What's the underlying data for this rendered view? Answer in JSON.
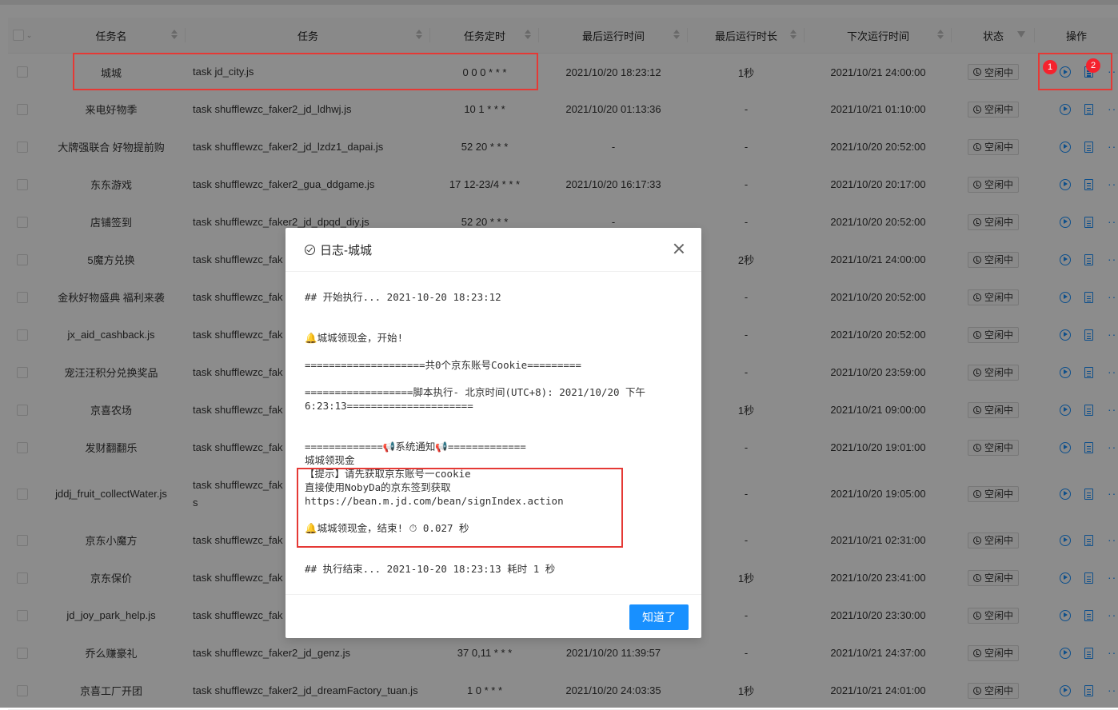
{
  "table": {
    "headers": {
      "name": "任务名",
      "task": "任务",
      "cron": "任务定时",
      "last_run": "最后运行时间",
      "last_duration": "最后运行时长",
      "next_run": "下次运行时间",
      "status": "状态",
      "ops": "操作"
    },
    "rows": [
      {
        "name": "城城",
        "task": "task jd_city.js",
        "cron": "0 0 0 * * *",
        "last": "2021/10/20 18:23:12",
        "dur": "1秒",
        "next": "2021/10/21 24:00:00",
        "status": "空闲中"
      },
      {
        "name": "来电好物季",
        "task": "task shufflewzc_faker2_jd_ldhwj.js",
        "cron": "10 1 * * *",
        "last": "2021/10/20 01:13:36",
        "dur": "-",
        "next": "2021/10/21 01:10:00",
        "status": "空闲中"
      },
      {
        "name": "大牌强联合 好物提前购",
        "task": "task shufflewzc_faker2_jd_lzdz1_dapai.js",
        "cron": "52 20 * * *",
        "last": "-",
        "dur": "-",
        "next": "2021/10/20 20:52:00",
        "status": "空闲中"
      },
      {
        "name": "东东游戏",
        "task": "task shufflewzc_faker2_gua_ddgame.js",
        "cron": "17 12-23/4 * * *",
        "last": "2021/10/20 16:17:33",
        "dur": "-",
        "next": "2021/10/20 20:17:00",
        "status": "空闲中"
      },
      {
        "name": "店铺签到",
        "task": "task shufflewzc_faker2_jd_dpqd_diy.js",
        "cron": "52 20 * * *",
        "last": "-",
        "dur": "-",
        "next": "2021/10/20 20:52:00",
        "status": "空闲中"
      },
      {
        "name": "5魔方兑换",
        "task": "task shufflewzc_fak",
        "cron": "",
        "last": "",
        "dur": "2秒",
        "next": "2021/10/21 24:00:00",
        "status": "空闲中"
      },
      {
        "name": "金秋好物盛典 福利来袭",
        "task": "task shufflewzc_fak",
        "cron": "",
        "last": "",
        "dur": "-",
        "next": "2021/10/20 20:52:00",
        "status": "空闲中"
      },
      {
        "name": "jx_aid_cashback.js",
        "task": "task shufflewzc_fak",
        "cron": "",
        "last": "",
        "dur": "-",
        "next": "2021/10/20 20:52:00",
        "status": "空闲中"
      },
      {
        "name": "宠汪汪积分兑换奖品",
        "task": "task shufflewzc_fak",
        "cron": "",
        "last": "",
        "dur": "-",
        "next": "2021/10/20 23:59:00",
        "status": "空闲中"
      },
      {
        "name": "京喜农场",
        "task": "task shufflewzc_fak",
        "cron": "",
        "last": "",
        "dur": "1秒",
        "next": "2021/10/21 09:00:00",
        "status": "空闲中"
      },
      {
        "name": "发财翻翻乐",
        "task": "task shufflewzc_fak",
        "cron": "",
        "last": "",
        "dur": "-",
        "next": "2021/10/20 19:01:00",
        "status": "空闲中"
      },
      {
        "name": "jddj_fruit_collectWater.js",
        "task": "task shufflewzc_fak",
        "task2": "s",
        "cron": "",
        "last": "",
        "dur": "-",
        "next": "2021/10/20 19:05:00",
        "status": "空闲中"
      },
      {
        "name": "京东小魔方",
        "task": "task shufflewzc_fak",
        "cron": "",
        "last": "",
        "dur": "-",
        "next": "2021/10/21 02:31:00",
        "status": "空闲中"
      },
      {
        "name": "京东保价",
        "task": "task shufflewzc_fak",
        "cron": "",
        "last": "",
        "dur": "1秒",
        "next": "2021/10/20 23:41:00",
        "status": "空闲中"
      },
      {
        "name": "jd_joy_park_help.js",
        "task": "task shufflewzc_fak",
        "cron": "",
        "last": "",
        "dur": "-",
        "next": "2021/10/20 23:30:00",
        "status": "空闲中"
      },
      {
        "name": "乔么赚豪礼",
        "task": "task shufflewzc_faker2_jd_genz.js",
        "cron": "37 0,11 * * *",
        "last": "2021/10/20 11:39:57",
        "dur": "-",
        "next": "2021/10/21 24:37:00",
        "status": "空闲中"
      },
      {
        "name": "京喜工厂开团",
        "task": "task shufflewzc_faker2_jd_dreamFactory_tuan.js",
        "cron": "1 0 * * *",
        "last": "2021/10/20 24:03:35",
        "dur": "1秒",
        "next": "2021/10/21 24:01:00",
        "status": "空闲中"
      }
    ]
  },
  "annotations": {
    "badge1": "1",
    "badge2": "2"
  },
  "modal": {
    "title": "日志-城城",
    "log_lines": [
      {
        "t": "## 开始执行... 2021-10-20 18:23:12",
        "gap": 0
      },
      {
        "t": "",
        "gap": 0
      },
      {
        "t": "",
        "gap": 0
      },
      {
        "t": "🔔城城领现金，开始!",
        "gap": 0
      },
      {
        "t": "",
        "gap": 0
      },
      {
        "t": "====================共0个京东账号Cookie=========",
        "gap": 0
      },
      {
        "t": "",
        "gap": 0
      },
      {
        "t": "==================脚本执行- 北京时间(UTC+8): 2021/10/20 下午",
        "gap": 0
      },
      {
        "t": "6:23:13=====================",
        "gap": 0
      },
      {
        "t": "",
        "gap": 0
      },
      {
        "t": "",
        "gap": 0
      },
      {
        "t": "=============📢系统通知📢=============",
        "gap": 0
      },
      {
        "t": "城城领现金",
        "gap": 0
      },
      {
        "t": "【提示】请先获取京东账号一cookie",
        "gap": 0
      },
      {
        "t": "直接使用NobyDa的京东签到获取",
        "gap": 0
      },
      {
        "t": "https://bean.m.jd.com/bean/signIndex.action",
        "gap": 0
      },
      {
        "t": "",
        "gap": 0
      },
      {
        "t": "🔔城城领现金，结束! ⏱ 0.027 秒",
        "gap": 0
      },
      {
        "t": "",
        "gap": 0
      },
      {
        "t": "",
        "gap": 0
      },
      {
        "t": "## 执行结束... 2021-10-20 18:23:13 耗时 1 秒",
        "gap": 0
      }
    ],
    "ok_label": "知道了"
  },
  "colors": {
    "accent": "#1890ff",
    "highlight": "#e53935"
  }
}
